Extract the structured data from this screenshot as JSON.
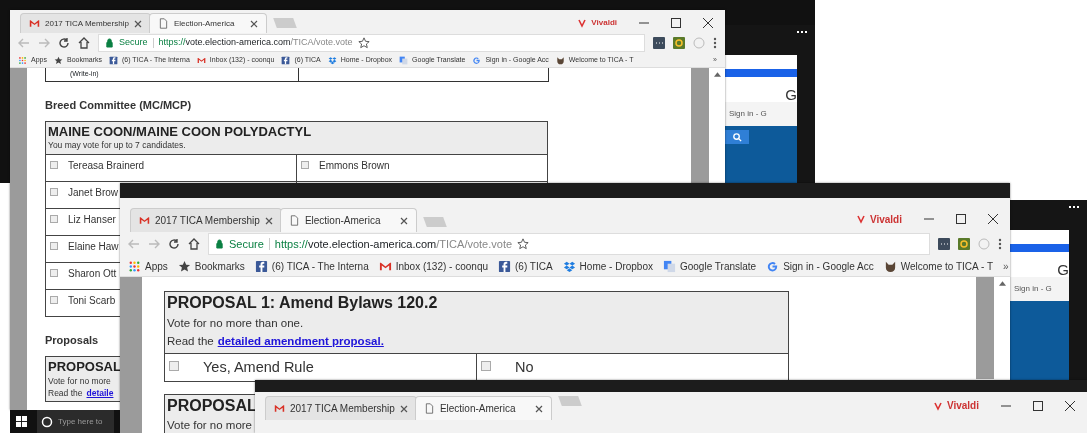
{
  "windows": [
    {
      "kind": "browser",
      "title_bar": false,
      "tabs": [
        {
          "label": "2017 TICA Membership",
          "kind": "gmail",
          "selected": false
        },
        {
          "label": "Election-America",
          "kind": "page",
          "selected": true
        }
      ],
      "brand": "Vivaldi",
      "address": {
        "secure": "Secure",
        "scheme": "https://",
        "host": "vote.election-america.com",
        "path": "/TICA/vote.vote"
      },
      "bookmarks": [
        {
          "label": "Apps",
          "kind": "apps"
        },
        {
          "label": "Bookmarks",
          "kind": "star"
        },
        {
          "label": "(6) TICA - The Interna",
          "kind": "facebook"
        },
        {
          "label": "Inbox (132) - coonqu",
          "kind": "gmail"
        },
        {
          "label": "(6) TICA",
          "kind": "facebook"
        },
        {
          "label": "Home - Dropbox",
          "kind": "dropbox"
        },
        {
          "label": "Google Translate",
          "kind": "translate"
        },
        {
          "label": "Sign in - Google Acc",
          "kind": "google"
        },
        {
          "label": "Welcome to TICA - T",
          "kind": "cat"
        }
      ],
      "bookmarks_more": "»",
      "page": [
        {
          "kind": "writein",
          "label": "(Write-in)"
        },
        {
          "kind": "heading",
          "text": "Breed Committee (MC/MCP)"
        },
        {
          "kind": "ballot",
          "title": "MAINE COON/MAINE COON POLYDACTYL",
          "notes": [
            {
              "text": "You may vote for up to 7 candidates."
            }
          ],
          "rows": [
            [
              {
                "label": "Tereasa Brainerd",
                "checked": false
              },
              {
                "label": "Emmons Brown",
                "checked": false
              }
            ],
            [
              {
                "label": "Janet Brow",
                "checked": false
              }
            ],
            [
              {
                "label": "Liz Hanser",
                "checked": false
              }
            ],
            [
              {
                "label": "Elaine Haw",
                "checked": false
              }
            ],
            [
              {
                "label": "Sharon Ott",
                "checked": false
              }
            ],
            [
              {
                "label": "Toni Scarb",
                "checked": false
              }
            ]
          ]
        },
        {
          "kind": "heading",
          "text": "Proposals"
        },
        {
          "kind": "ballot",
          "title": "PROPOSAL",
          "notes": [
            {
              "text": "Vote for no more"
            },
            {
              "text": "Read the",
              "link": "detaile"
            }
          ]
        }
      ]
    },
    {
      "kind": "browser",
      "title_bar": true,
      "tabs": [
        {
          "label": "2017 TICA Membership",
          "kind": "gmail",
          "selected": false
        },
        {
          "label": "Election-America",
          "kind": "page",
          "selected": true
        }
      ],
      "brand": "Vivaldi",
      "address": {
        "secure": "Secure",
        "scheme": "https://",
        "host": "vote.election-america.com",
        "path": "/TICA/vote.vote"
      },
      "bookmarks": [
        {
          "label": "Apps",
          "kind": "apps"
        },
        {
          "label": "Bookmarks",
          "kind": "star"
        },
        {
          "label": "(6) TICA - The Interna",
          "kind": "facebook"
        },
        {
          "label": "Inbox (132) - coonqu",
          "kind": "gmail"
        },
        {
          "label": "(6) TICA",
          "kind": "facebook"
        },
        {
          "label": "Home - Dropbox",
          "kind": "dropbox"
        },
        {
          "label": "Google Translate",
          "kind": "translate"
        },
        {
          "label": "Sign in - Google Acc",
          "kind": "google"
        },
        {
          "label": "Welcome to TICA - T",
          "kind": "cat"
        }
      ],
      "bookmarks_more": "»",
      "page": [
        {
          "kind": "ballot",
          "title": "PROPOSAL 1: Amend Bylaws 120.2",
          "notes": [
            {
              "text": "Vote for no more than one."
            },
            {
              "text": "Read the",
              "link": "detailed amendment proposal."
            }
          ],
          "rows": [
            [
              {
                "label": "Yes, Amend Rule",
                "checked": false
              },
              {
                "label": "No",
                "checked": false
              }
            ]
          ]
        },
        {
          "kind": "ballot",
          "title": "PROPOSAL",
          "notes": [
            {
              "text": "Vote for no more"
            }
          ]
        }
      ]
    },
    {
      "kind": "browser",
      "title_bar": true,
      "tabs": [
        {
          "label": "2017 TICA Membership",
          "kind": "gmail",
          "selected": false
        },
        {
          "label": "Election-America",
          "kind": "page",
          "selected": true
        }
      ],
      "brand": "Vivaldi"
    }
  ],
  "background_windows": [
    {
      "link": "Sign in - G",
      "letter": "G",
      "search_button": true
    },
    {
      "link": "Sign in - G",
      "letter": "G",
      "search_button": false
    }
  ],
  "taskbar": {
    "search_placeholder": "Type here to"
  }
}
